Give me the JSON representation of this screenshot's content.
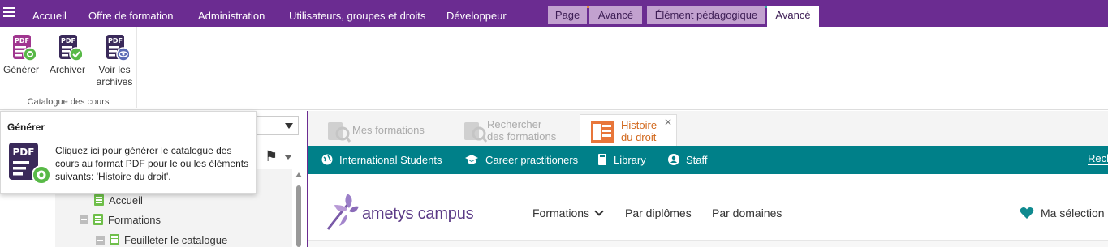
{
  "topbar": {
    "menu": [
      "Accueil",
      "Offre de formation",
      "Administration",
      "Utilisateurs, groupes et droits",
      "Développeur"
    ],
    "context_tabs": [
      "Page",
      "Avancé",
      "Élément pédagogique",
      "Avancé"
    ],
    "accent": "#6b2c91"
  },
  "ribbon": {
    "buttons": [
      {
        "label": "Générer",
        "icon": "pdf-generate-icon"
      },
      {
        "label": "Archiver",
        "icon": "pdf-archive-icon"
      },
      {
        "label": "Voir les archives",
        "label_line1": "Voir les",
        "label_line2": "archives",
        "icon": "pdf-view-icon"
      }
    ],
    "group_label": "Catalogue des cours"
  },
  "tooltip": {
    "title": "Générer",
    "text": "Cliquez ici pour générer le catalogue des cours au format PDF pour le ou les éléments suivants: 'Histoire du droit'."
  },
  "tree": {
    "items": [
      {
        "label": "Accueil"
      },
      {
        "label": "Formations"
      },
      {
        "label": "Feuilleter le catalogue"
      }
    ]
  },
  "doc_tabs": [
    {
      "label_line1": "Mes formations",
      "label_line2": ""
    },
    {
      "label_line1": "Rechercher",
      "label_line2": "des formations"
    },
    {
      "label_line1": "Histoire",
      "label_line2": "du droit",
      "active": true
    }
  ],
  "site": {
    "teal_color": "#008089",
    "top_links": [
      "International Students",
      "Career practitioners",
      "Library",
      "Staff"
    ],
    "search_label": "Rech",
    "logo_text": "ametys campus",
    "nav": [
      "Formations",
      "Par diplômes",
      "Par domaines"
    ],
    "selection_label": "Ma sélection"
  }
}
